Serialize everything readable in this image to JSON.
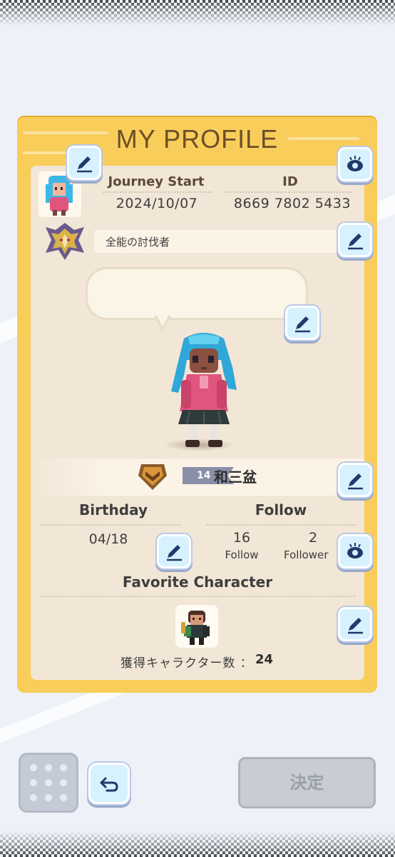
{
  "card": {
    "title": "MY PROFILE"
  },
  "profile": {
    "journey_label": "Journey Start",
    "journey_value": "2024/10/07",
    "id_label": "ID",
    "id_value": "8669 7802 5433",
    "title_text": "全能の討伐者",
    "speech_text": "",
    "level": "14",
    "player_name": "和三盆"
  },
  "birthday": {
    "label": "Birthday",
    "value": "04/18"
  },
  "follow": {
    "label": "Follow",
    "follow_count": "16",
    "follow_sub": "Follow",
    "follower_count": "2",
    "follower_sub": "Follower"
  },
  "favorite": {
    "label": "Favorite Character",
    "count_label": "獲得キャラクター数 ：",
    "count_value": "24"
  },
  "bottom": {
    "decide_label": "決定"
  },
  "colors": {
    "card_yellow": "#f9cd5a",
    "panel_beige": "#f2e6d6",
    "button_blue": "#d7f1ff",
    "icon_navy": "#1f3b6b",
    "disabled_gray": "#c9ccd3"
  },
  "icons": [
    "pencil-icon",
    "eye-icon",
    "back-arrow-icon",
    "grid-dots-icon"
  ]
}
